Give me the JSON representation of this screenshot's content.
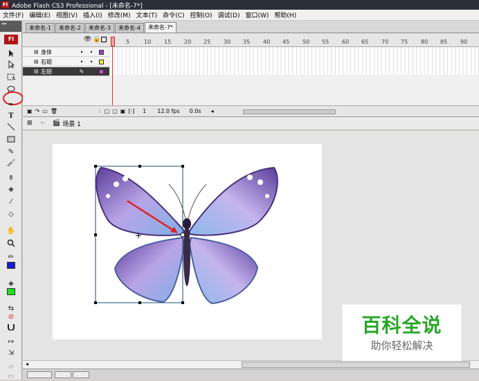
{
  "window": {
    "title": "Adobe Flash CS3 Professional - [未命名-7*]"
  },
  "menu": [
    "文件(F)",
    "编辑(E)",
    "视图(V)",
    "插入(I)",
    "修改(M)",
    "文本(T)",
    "命令(C)",
    "控制(O)",
    "调试(D)",
    "窗口(W)",
    "帮助(H)"
  ],
  "toolbox": {
    "logo": "Fl"
  },
  "documentTabs": [
    "未命名-1",
    "未命名-2",
    "未命名-3",
    "未命名-4",
    "未命名-7*"
  ],
  "timeline": {
    "ruler": [
      "5",
      "10",
      "15",
      "20",
      "25",
      "30",
      "35",
      "40",
      "45",
      "50",
      "55",
      "60",
      "65",
      "70",
      "75",
      "80",
      "85",
      "90"
    ],
    "layers": [
      {
        "name": "身体",
        "color": "#9b3fcf",
        "selected": false
      },
      {
        "name": "右翅",
        "color": "#f0f030",
        "selected": false
      },
      {
        "name": "左翅",
        "color": "#e040e0",
        "selected": true
      }
    ],
    "status": {
      "frame": "1",
      "fps": "12.0 fps",
      "time": "0.0s"
    }
  },
  "editbar": {
    "scene": "场景 1"
  },
  "colors": {
    "stroke": "#1a1ad0",
    "fill": "#20e020"
  },
  "watermark": {
    "title": "百科全说",
    "subtitle": "助你轻松解决"
  }
}
